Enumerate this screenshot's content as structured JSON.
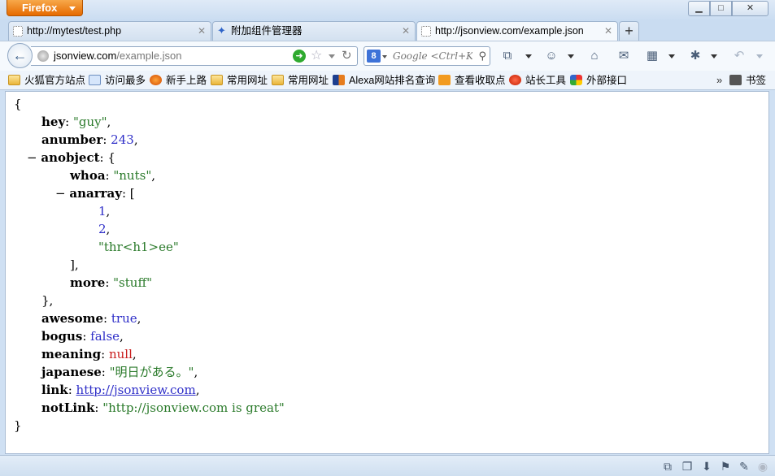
{
  "titlebar": {
    "app_button": "Firefox",
    "minimize_glyph": "▁",
    "maximize_glyph": "□",
    "close_glyph": "✕"
  },
  "tabs": [
    {
      "title": "http://mytest/test.php",
      "icon": "blank-page-icon",
      "close": "✕"
    },
    {
      "title": "附加组件管理器",
      "icon": "puzzle-icon",
      "close": "✕"
    },
    {
      "title": "http://jsonview.com/example.json",
      "icon": "blank-page-icon",
      "close": "✕",
      "active": true
    }
  ],
  "new_tab_label": "+",
  "navbar": {
    "url_host": "jsonview.com",
    "url_path": "/example.json",
    "search_placeholder": "Google <Ctrl+K>",
    "search_engine": "8"
  },
  "bookmarks": [
    {
      "label": "火狐官方站点",
      "icon": "folder-icon"
    },
    {
      "label": "访问最多",
      "icon": "page-icon"
    },
    {
      "label": "新手上路",
      "icon": "firefox-icon"
    },
    {
      "label": "常用网址",
      "icon": "folder-icon"
    },
    {
      "label": "常用网址",
      "icon": "folder-icon"
    },
    {
      "label": "Alexa网站排名查询",
      "icon": "alexa-icon"
    },
    {
      "label": "查看收取点",
      "icon": "rss-icon"
    },
    {
      "label": "站长工具",
      "icon": "red-globe-icon"
    },
    {
      "label": "外部接口",
      "icon": "multicolor-icon"
    }
  ],
  "bookmarks_more": "»",
  "bookmarks_menu": "书签",
  "json_view": {
    "open_brace": "{",
    "close_brace": "}",
    "hey": {
      "key": "hey",
      "value": "\"guy\""
    },
    "anumber": {
      "key": "anumber",
      "value": "243"
    },
    "anobject": {
      "key": "anobject",
      "collapser": "−",
      "whoa": {
        "key": "whoa",
        "value": "\"nuts\""
      },
      "anarray": {
        "key": "anarray",
        "collapser": "−",
        "items": [
          "1",
          "2",
          "\"thr<h1>ee\""
        ]
      },
      "more": {
        "key": "more",
        "value": "\"stuff\""
      }
    },
    "awesome": {
      "key": "awesome",
      "value": "true"
    },
    "bogus": {
      "key": "bogus",
      "value": "false"
    },
    "meaning": {
      "key": "meaning",
      "value": "null"
    },
    "japanese": {
      "key": "japanese",
      "value": "\"明日がある。\""
    },
    "link": {
      "key": "link",
      "value": "http://jsonview.com"
    },
    "notLink": {
      "key": "notLink",
      "value": "\"http://jsonview.com is great\""
    }
  }
}
